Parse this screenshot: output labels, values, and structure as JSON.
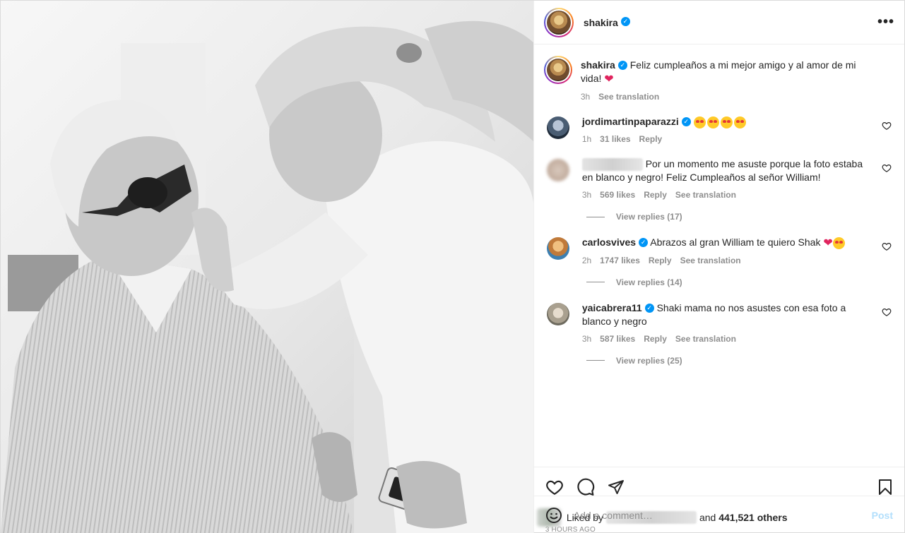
{
  "photo": {
    "alt": "Black and white photo"
  },
  "header": {
    "username": "shakira",
    "more_label": "•••"
  },
  "caption": {
    "username": "shakira",
    "text": "Feliz cumpleaños a mi mejor amigo y al amor de mi vida!",
    "time": "3h",
    "see_translation": "See translation"
  },
  "comments": [
    {
      "username": "jordimartinpaparazzi",
      "text": "",
      "time": "1h",
      "likes": "31 likes",
      "reply": "Reply",
      "see_translation": "",
      "view_replies": ""
    },
    {
      "username": "",
      "text": "Por un momento me asuste porque la foto estaba en blanco y negro! Feliz Cumpleaños al señor William!",
      "time": "3h",
      "likes": "569 likes",
      "reply": "Reply",
      "see_translation": "See translation",
      "view_replies": "View replies (17)"
    },
    {
      "username": "carlosvives",
      "text": "Abrazos al gran William te quiero Shak",
      "time": "2h",
      "likes": "1747 likes",
      "reply": "Reply",
      "see_translation": "See translation",
      "view_replies": "View replies (14)"
    },
    {
      "username": "yaicabrera11",
      "text": "Shaki mama no nos asustes con esa foto a blanco y negro",
      "time": "3h",
      "likes": "587 likes",
      "reply": "Reply",
      "see_translation": "See translation",
      "view_replies": "View replies (25)"
    }
  ],
  "likes": {
    "prefix": "Liked by",
    "conjunction": "and",
    "count": "441,521 others"
  },
  "timestamp": "3 HOURS AGO",
  "add_comment": {
    "placeholder": "Add a comment…",
    "post_label": "Post"
  },
  "colors": {
    "accent": "#0095f6",
    "muted": "#8e8e8e",
    "heart": "#e0245e"
  }
}
